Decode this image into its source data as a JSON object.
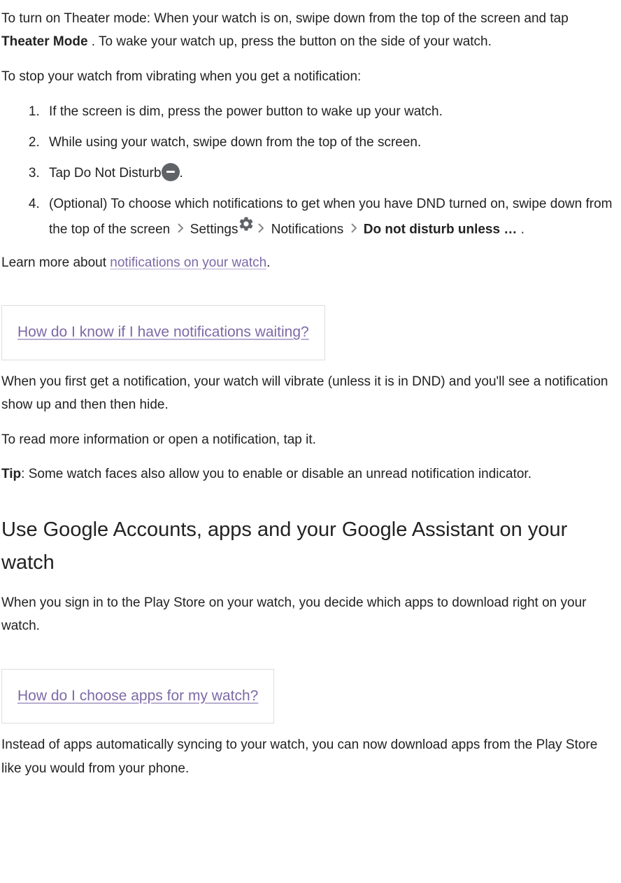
{
  "intro": {
    "p1_a": "To turn on Theater mode: When your watch is on, swipe down from the top of the screen and tap ",
    "p1_bold": "Theater Mode",
    "p1_b": " . To wake your watch up, press the button on the side of your watch.",
    "p2": "To stop your watch from vibrating when you get a notification:"
  },
  "list": {
    "item1": "If the screen is dim, press the power button to wake up your watch.",
    "item2": "While using your watch, swipe down from the top of the screen.",
    "item3_a": "Tap Do Not Disturb",
    "item3_b": ".",
    "item4_a": "(Optional) To choose which notifications to get when you have DND turned on, swipe down from the top of the screen ",
    "item4_settings": " Settings",
    "item4_notifications": " Notifications ",
    "item4_bold": "Do not disturb unless …",
    "item4_end": " ."
  },
  "learn": {
    "a": "Learn more about ",
    "link": "notifications on your watch",
    "b": "."
  },
  "callout1": "How do I know if I have notifications waiting?",
  "after1": {
    "p1": "When you first get a notification, your watch will vibrate (unless it is in DND) and you'll see a notification show up and then then hide.",
    "p2": "To read more information or open a notification, tap it.",
    "p3_bold": "Tip",
    "p3_rest": ": Some watch faces also allow you to enable or disable an unread notification indicator."
  },
  "heading": "Use Google Accounts, apps and your Google Assistant on your watch",
  "section2": {
    "p1": "When you sign in to the Play Store on your watch, you decide which apps to download right on your watch."
  },
  "callout2": "How do I choose apps for my watch?",
  "after2": {
    "p1": "Instead of apps automatically syncing to your watch, you can now download apps from the Play Store like you would from your phone."
  }
}
